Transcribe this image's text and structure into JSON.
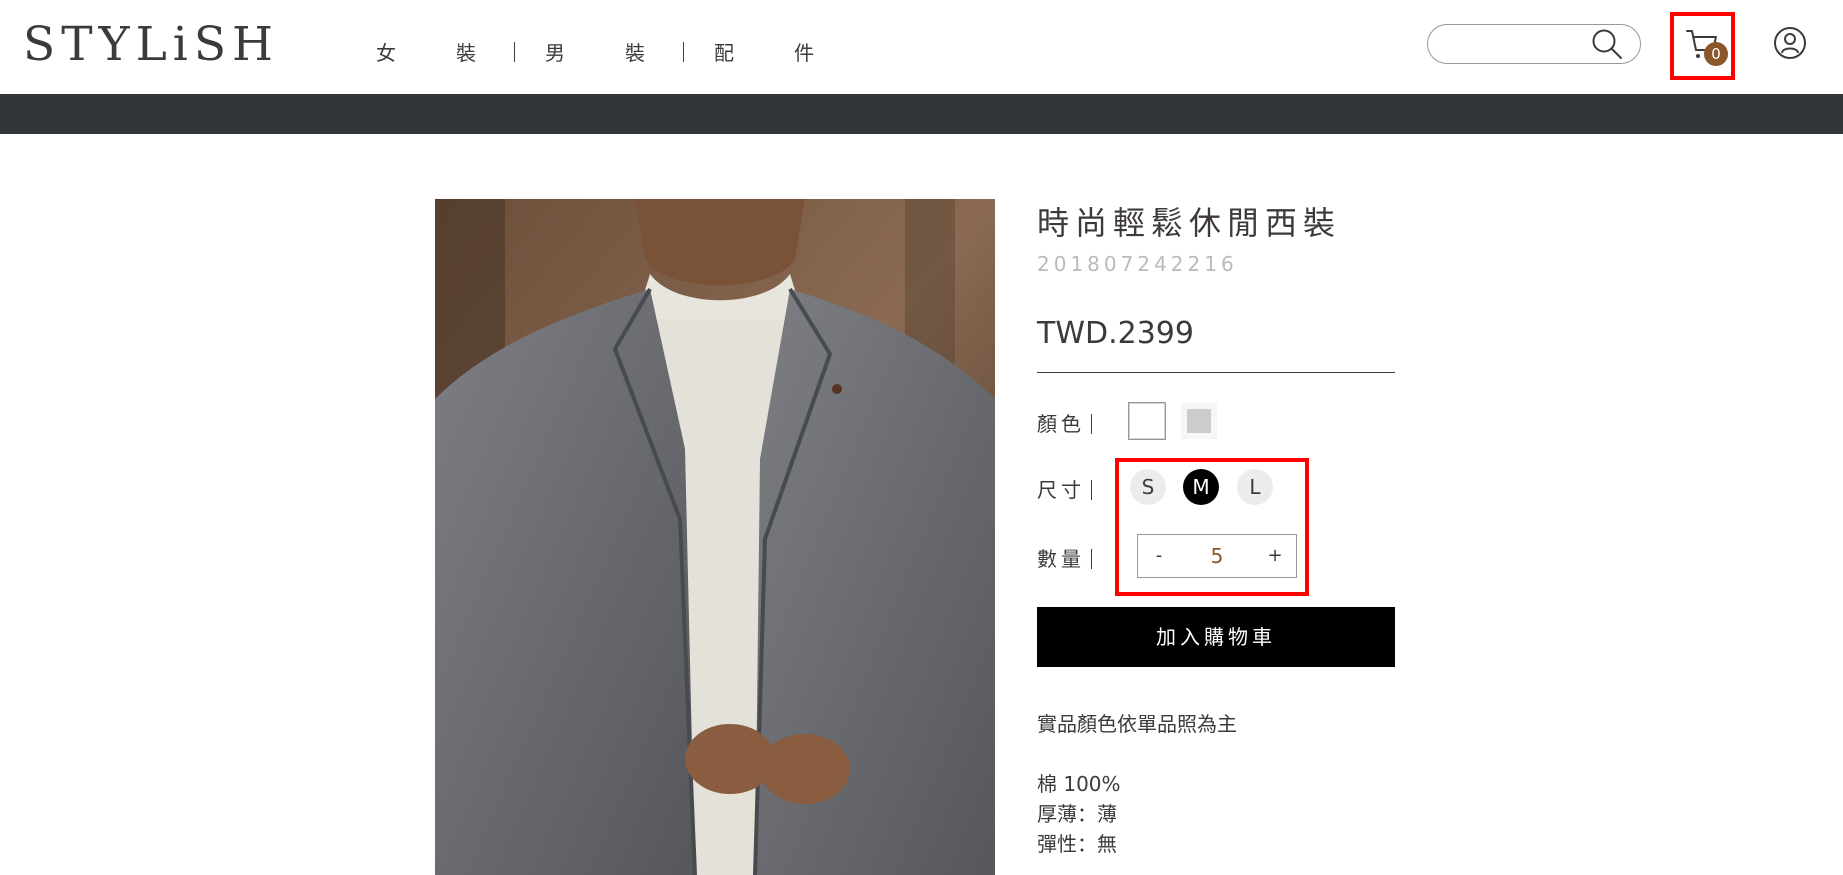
{
  "header": {
    "logo": "STYLiSH",
    "nav": [
      "女　裝",
      "男　裝",
      "配　件"
    ],
    "search_placeholder": "",
    "cart_count": "0"
  },
  "product": {
    "title": "時尚輕鬆休閒西裝",
    "id": "201807242216",
    "price": "TWD.2399",
    "color_label": "顏色",
    "colors": [
      "#FFFFFF",
      "#CCCCCC"
    ],
    "selected_color_index": 0,
    "size_label": "尺寸",
    "sizes": [
      "S",
      "M",
      "L"
    ],
    "selected_size": "M",
    "quantity_label": "數量",
    "quantity": "5",
    "minus_label": "-",
    "plus_label": "+",
    "add_to_cart": "加入購物車",
    "note": "實品顏色依單品照為主",
    "texture": "棉 100%",
    "thickness": "厚薄：薄",
    "elasticity": "彈性：無"
  },
  "colors": {
    "accent": "#8B572A",
    "dark_bar": "#313538",
    "highlight": "#FF0000"
  }
}
